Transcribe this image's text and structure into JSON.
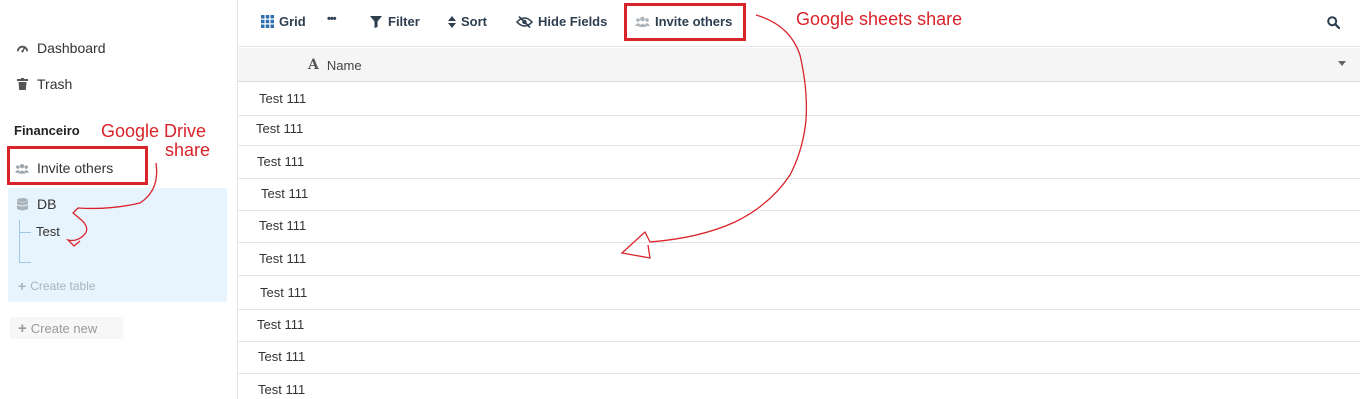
{
  "sidebar": {
    "dashboard_label": "Dashboard",
    "trash_label": "Trash",
    "section_title": "Financeiro",
    "invite_label": "Invite others",
    "db_label": "DB",
    "table_label": "Test",
    "create_table_label": "Create table",
    "create_new_label": "Create new"
  },
  "toolbar": {
    "grid_label": "Grid",
    "more_label": "•••",
    "filter_label": "Filter",
    "sort_label": "Sort",
    "hide_fields_label": "Hide Fields",
    "invite_label": "Invite others"
  },
  "table": {
    "column_name": "Name",
    "rows": [
      "Test 111",
      "Test 111",
      "Test 111",
      "Test 111",
      "Test 111",
      "Test 111",
      "Test 111",
      "Test 111",
      "Test 111",
      "Test 111"
    ]
  },
  "annotations": {
    "drive_line1": "Google Drive",
    "drive_line2": "share",
    "sheets": "Google sheets share",
    "color": "#d9232a"
  }
}
